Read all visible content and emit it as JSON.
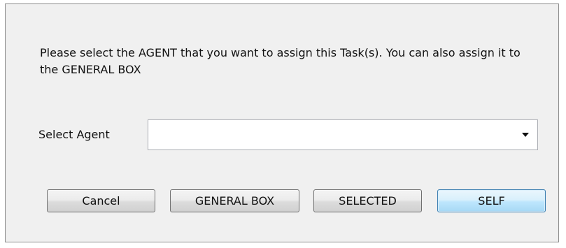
{
  "dialog": {
    "message": "Please select the AGENT that you want to assign this Task(s). You can also assign it to the GENERAL BOX",
    "select_agent": {
      "label": "Select Agent",
      "value": "",
      "icon": "chevron-down-icon"
    },
    "buttons": {
      "cancel": "Cancel",
      "general_box": "GENERAL BOX",
      "selected": "SELECTED",
      "self": "SELF"
    },
    "colors": {
      "background": "#f0f0f0",
      "default_button_border": "#3c7fb1"
    }
  }
}
